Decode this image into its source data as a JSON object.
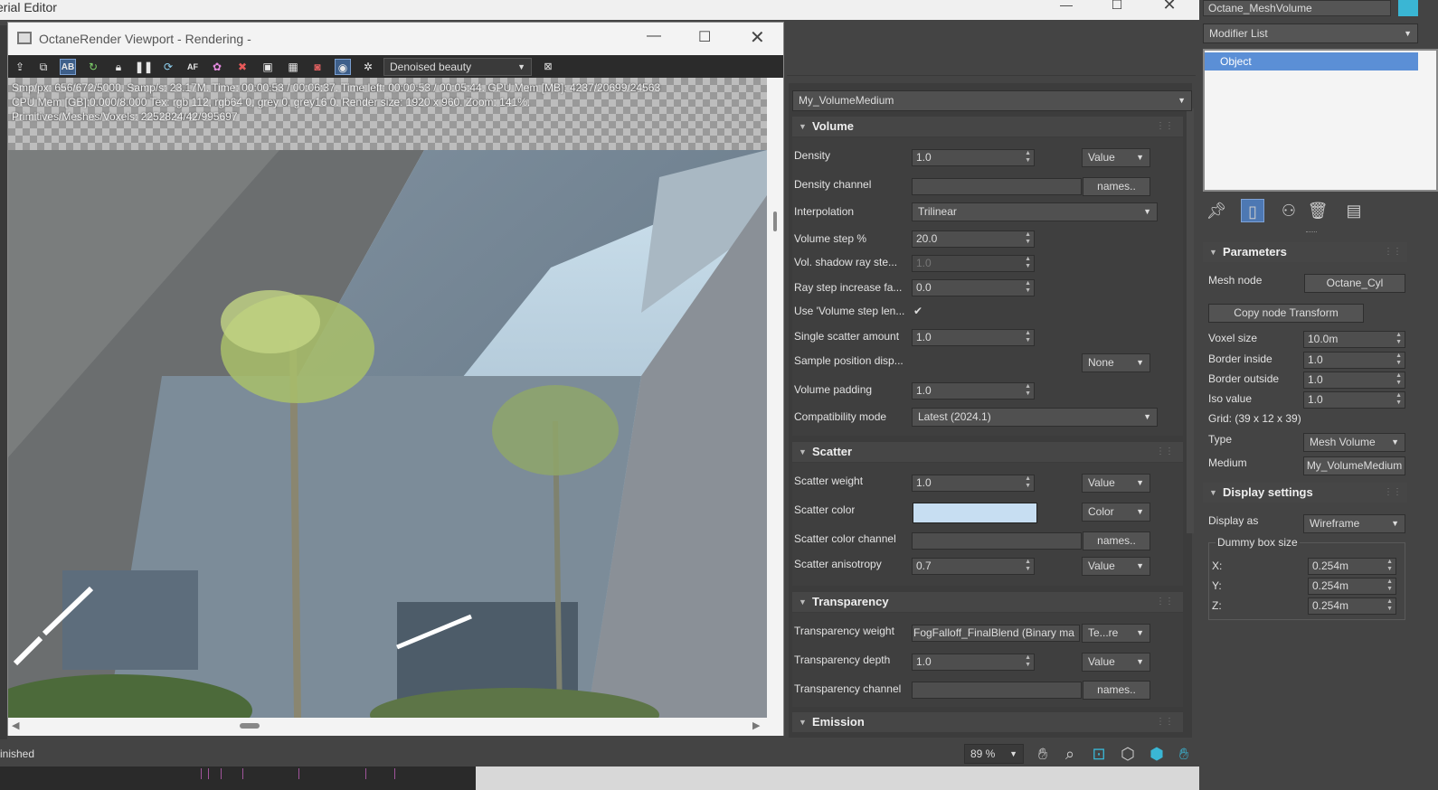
{
  "material_editor": {
    "title": "erial Editor",
    "medium_selector": "My_VolumeMedium",
    "sections": {
      "volume": {
        "title": "Volume",
        "density": {
          "label": "Density",
          "value": "1.0",
          "mode": "Value"
        },
        "density_channel": {
          "label": "Density channel",
          "button": "names.."
        },
        "interpolation": {
          "label": "Interpolation",
          "value": "Trilinear"
        },
        "volume_step": {
          "label": "Volume step %",
          "value": "20.0"
        },
        "vol_shadow_ray": {
          "label": "Vol. shadow ray ste...",
          "value": "1.0"
        },
        "ray_step_increase": {
          "label": "Ray step increase fa...",
          "value": "0.0"
        },
        "use_volume_step": {
          "label": "Use 'Volume step len...",
          "checked": "✔"
        },
        "single_scatter": {
          "label": "Single scatter amount",
          "value": "1.0"
        },
        "sample_position": {
          "label": "Sample position disp...",
          "value": "None"
        },
        "volume_padding": {
          "label": "Volume padding",
          "value": "1.0"
        },
        "compat_mode": {
          "label": "Compatibility mode",
          "value": "Latest (2024.1)"
        }
      },
      "scatter": {
        "title": "Scatter",
        "weight": {
          "label": "Scatter weight",
          "value": "1.0",
          "mode": "Value"
        },
        "color": {
          "label": "Scatter color",
          "swatch": "#c7def2",
          "mode": "Color"
        },
        "color_channel": {
          "label": "Scatter color channel",
          "button": "names.."
        },
        "anisotropy": {
          "label": "Scatter anisotropy",
          "value": "0.7",
          "mode": "Value"
        }
      },
      "transparency": {
        "title": "Transparency",
        "weight": {
          "label": "Transparency weight",
          "value": "FogFalloff_FinalBlend (Binary ma",
          "mode": "Te...re"
        },
        "depth": {
          "label": "Transparency depth",
          "value": "1.0",
          "mode": "Value"
        },
        "channel": {
          "label": "Transparency channel",
          "button": "names.."
        }
      },
      "emission": {
        "title": "Emission"
      }
    }
  },
  "viewport": {
    "title": "OctaneRender Viewport - Rendering -",
    "pass_selector": "Denoised beauty",
    "stats": [
      "Smp/px: 656/672/5000.   Samp/s: 23.17M.   Time: 00:00:53 / 00:06:37.   Time left: 00:00:53 / 00:05:44.   GPU Mem [MB]: 4237/20699/24563",
      "CPU Mem [GB]:0.000/8.000   Tex: rgb 112, rgb64 0, grey 0, grey16 0.   Render size: 1920 x 960.   Zoom: 141%.",
      "Primitives/Meshes/Voxels: 2252824/42/995697"
    ],
    "toolbar_icons": [
      "send-scene-icon",
      "copy-icon",
      "ab-compare-icon",
      "restart-icon",
      "lock-icon",
      "pause-icon",
      "refresh-icon",
      "af-icon",
      "color-picker-icon",
      "region-icon",
      "screen-icon",
      "film-icon",
      "camera-icon",
      "viewport-lock-icon",
      "settings-icon"
    ]
  },
  "command_panel": {
    "object_name": "Octane_MeshVolume",
    "modifier_list": "Modifier List",
    "stack_item": "Object",
    "parameters": {
      "title": "Parameters",
      "mesh_node": {
        "label": "Mesh node",
        "value": "Octane_Cyl"
      },
      "copy_node_transform": "Copy node Transform",
      "voxel_size": {
        "label": "Voxel size",
        "value": "10.0m"
      },
      "border_inside": {
        "label": "Border inside",
        "value": "1.0"
      },
      "border_outside": {
        "label": "Border outside",
        "value": "1.0"
      },
      "iso_value": {
        "label": "Iso value",
        "value": "1.0"
      },
      "grid": "Grid: (39 x 12 x 39)",
      "type": {
        "label": "Type",
        "value": "Mesh Volume"
      },
      "medium": {
        "label": "Medium",
        "value": "My_VolumeMedium"
      }
    },
    "display_settings": {
      "title": "Display settings",
      "display_as": {
        "label": "Display as",
        "value": "Wireframe"
      },
      "dummy_box": "Dummy box size",
      "x": {
        "label": "X:",
        "value": "0.254m"
      },
      "y": {
        "label": "Y:",
        "value": "0.254m"
      },
      "z": {
        "label": "Z:",
        "value": "0.254m"
      }
    }
  },
  "status_bar": {
    "status_text": "inished",
    "zoom": "89 %"
  },
  "colors": {
    "selection_blue": "#5b8fd6",
    "accent_cyan": "#3ab6d4"
  }
}
